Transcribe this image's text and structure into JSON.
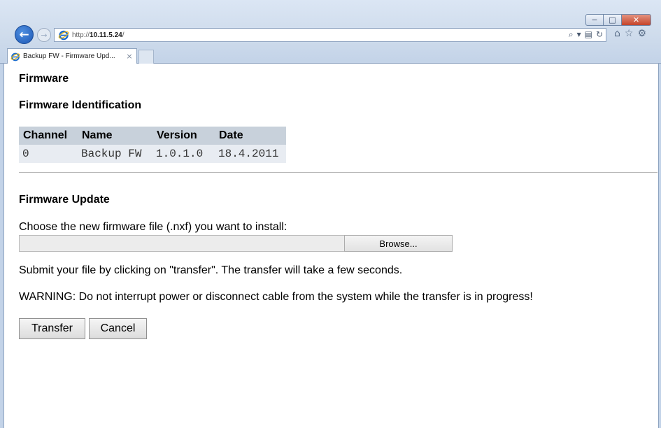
{
  "browser": {
    "url_prefix": "http://",
    "url_host": "10.11.5.24",
    "url_suffix": "/",
    "tab_title": "Backup FW - Firmware Upd...",
    "tab_close": "×",
    "window_controls": {
      "minimize": "−",
      "maximize": "□",
      "close": "✕"
    },
    "address_tools": {
      "search": "⌕",
      "dropdown": "▾",
      "compat": "▤",
      "refresh": "↻"
    },
    "nav_icons": {
      "home": "⌂",
      "favorites": "☆",
      "tools": "⚙"
    },
    "back": "←",
    "forward": "→"
  },
  "page": {
    "title": "Firmware",
    "identification_heading": "Firmware Identification",
    "table": {
      "headers": [
        "Channel",
        "Name",
        "Version",
        "Date"
      ],
      "rows": [
        [
          "0",
          "Backup FW",
          "1.0.1.0",
          "18.4.2011"
        ]
      ]
    },
    "update_heading": "Firmware Update",
    "choose_label": "Choose the new firmware file (.nxf) you want to install:",
    "file_value": "",
    "browse_label": "Browse...",
    "submit_text": "Submit your file by clicking on \"transfer\". The transfer will take a few seconds.",
    "warning_text": "WARNING: Do not interrupt power or disconnect cable from the system while the transfer is in progress!",
    "transfer_label": "Transfer",
    "cancel_label": "Cancel"
  }
}
